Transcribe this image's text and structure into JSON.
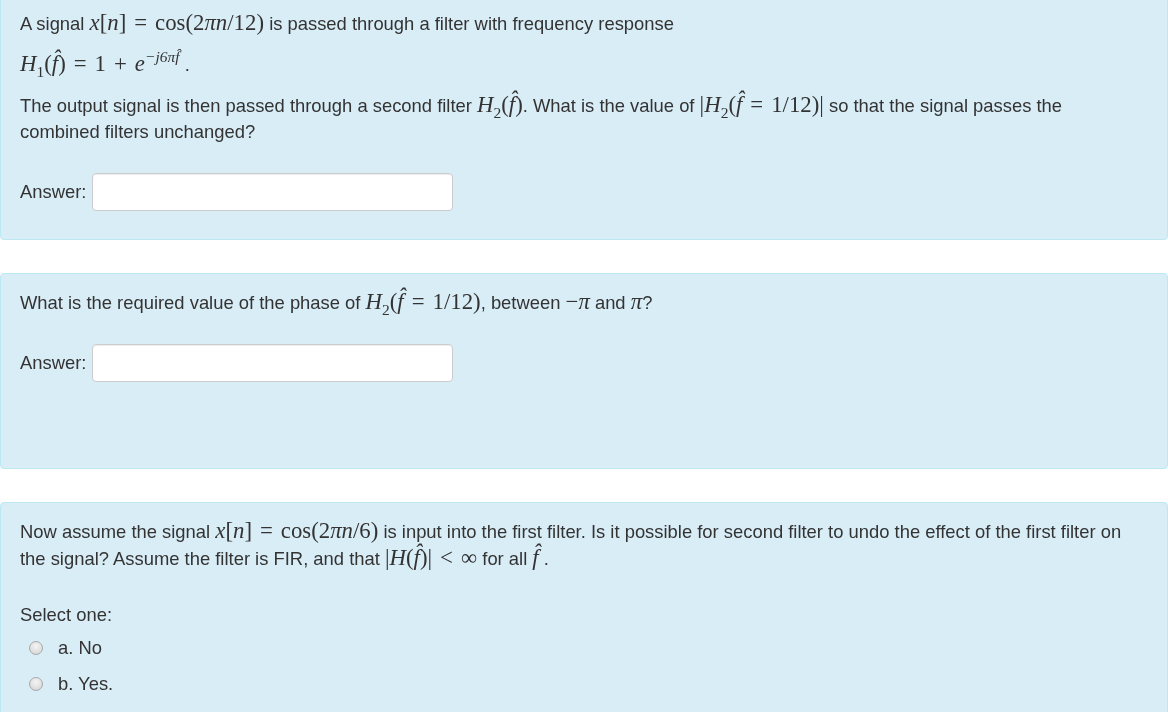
{
  "questions": [
    {
      "kind": "short_answer",
      "paragraphs": [
        [
          {
            "kind": "text",
            "text": "A signal "
          },
          {
            "kind": "math",
            "text": "*x*[*n*] = cos(2"
          },
          {
            "kind": "math",
            "text": "*πn*/12)"
          },
          {
            "kind": "text",
            "text": " is passed through a filter with frequency response"
          }
        ],
        [
          {
            "kind": "math",
            "text": "*H*$_{1}$(*f̂*) = 1 + *e*$^{−j6πf̂}$"
          },
          {
            "kind": "text",
            "text": " ."
          }
        ],
        [
          {
            "kind": "text",
            "text": "The output signal is then passed through a second filter "
          },
          {
            "kind": "math",
            "text": "*H*$_{2}$(*f̂*)"
          },
          {
            "kind": "text",
            "text": ". What is the value of "
          },
          {
            "kind": "math",
            "text": "|*H*$_{2}$(*f̂* = 1/12)|"
          },
          {
            "kind": "text",
            "text": " so that the signal passes the combined filters unchanged?"
          }
        ]
      ],
      "answer": {
        "label": "Answer:"
      }
    },
    {
      "kind": "short_answer",
      "paragraphs": [
        [
          {
            "kind": "text",
            "text": "What is the required value of the phase of "
          },
          {
            "kind": "math",
            "text": "*H*$_{2}$(*f̂* = 1/12)"
          },
          {
            "kind": "text",
            "text": ", between "
          },
          {
            "kind": "math",
            "text": "−*π*"
          },
          {
            "kind": "text",
            "text": " and "
          },
          {
            "kind": "math",
            "text": "*π*"
          },
          {
            "kind": "text",
            "text": "?"
          }
        ]
      ],
      "answer": {
        "label": "Answer:"
      }
    },
    {
      "kind": "multiple_choice",
      "paragraphs": [
        [
          {
            "kind": "text",
            "text": "Now assume the signal "
          },
          {
            "kind": "math",
            "text": "*x*[*n*] = cos(2"
          },
          {
            "kind": "math",
            "text": "*πn*/6)"
          },
          {
            "kind": "text",
            "text": " is input into the first filter. Is it possible for second filter to undo the effect of the first filter on the signal? Assume the filter is FIR, and that "
          },
          {
            "kind": "math",
            "text": "|*H*(*f̂*)| < ∞"
          },
          {
            "kind": "text",
            "text": " for all "
          },
          {
            "kind": "math",
            "text": "*f̂*"
          },
          {
            "kind": "text",
            "text": " ."
          }
        ]
      ],
      "prompt": "Select one:",
      "options": [
        {
          "label": "a. No",
          "selected": false
        },
        {
          "label": "b. Yes.",
          "selected": false
        }
      ]
    }
  ]
}
